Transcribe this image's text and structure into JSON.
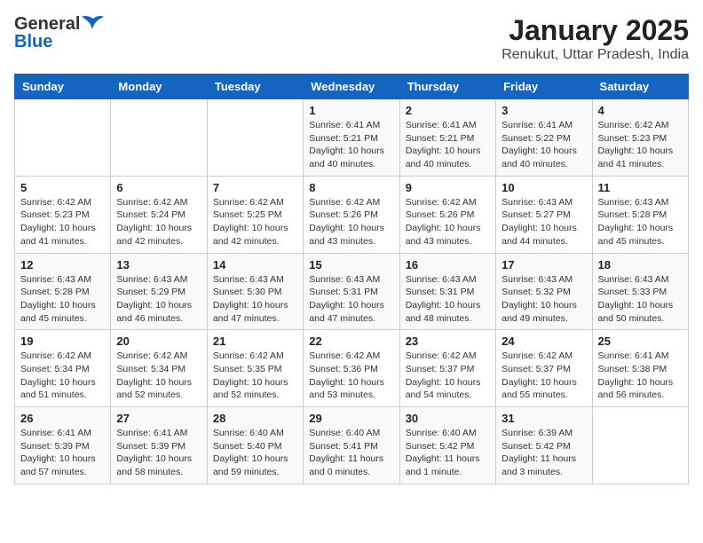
{
  "header": {
    "logo_general": "General",
    "logo_blue": "Blue",
    "title": "January 2025",
    "subtitle": "Renukut, Uttar Pradesh, India"
  },
  "days_of_week": [
    "Sunday",
    "Monday",
    "Tuesday",
    "Wednesday",
    "Thursday",
    "Friday",
    "Saturday"
  ],
  "weeks": [
    [
      {
        "day": "",
        "info": ""
      },
      {
        "day": "",
        "info": ""
      },
      {
        "day": "",
        "info": ""
      },
      {
        "day": "1",
        "info": "Sunrise: 6:41 AM\nSunset: 5:21 PM\nDaylight: 10 hours\nand 40 minutes."
      },
      {
        "day": "2",
        "info": "Sunrise: 6:41 AM\nSunset: 5:21 PM\nDaylight: 10 hours\nand 40 minutes."
      },
      {
        "day": "3",
        "info": "Sunrise: 6:41 AM\nSunset: 5:22 PM\nDaylight: 10 hours\nand 40 minutes."
      },
      {
        "day": "4",
        "info": "Sunrise: 6:42 AM\nSunset: 5:23 PM\nDaylight: 10 hours\nand 41 minutes."
      }
    ],
    [
      {
        "day": "5",
        "info": "Sunrise: 6:42 AM\nSunset: 5:23 PM\nDaylight: 10 hours\nand 41 minutes."
      },
      {
        "day": "6",
        "info": "Sunrise: 6:42 AM\nSunset: 5:24 PM\nDaylight: 10 hours\nand 42 minutes."
      },
      {
        "day": "7",
        "info": "Sunrise: 6:42 AM\nSunset: 5:25 PM\nDaylight: 10 hours\nand 42 minutes."
      },
      {
        "day": "8",
        "info": "Sunrise: 6:42 AM\nSunset: 5:26 PM\nDaylight: 10 hours\nand 43 minutes."
      },
      {
        "day": "9",
        "info": "Sunrise: 6:42 AM\nSunset: 5:26 PM\nDaylight: 10 hours\nand 43 minutes."
      },
      {
        "day": "10",
        "info": "Sunrise: 6:43 AM\nSunset: 5:27 PM\nDaylight: 10 hours\nand 44 minutes."
      },
      {
        "day": "11",
        "info": "Sunrise: 6:43 AM\nSunset: 5:28 PM\nDaylight: 10 hours\nand 45 minutes."
      }
    ],
    [
      {
        "day": "12",
        "info": "Sunrise: 6:43 AM\nSunset: 5:28 PM\nDaylight: 10 hours\nand 45 minutes."
      },
      {
        "day": "13",
        "info": "Sunrise: 6:43 AM\nSunset: 5:29 PM\nDaylight: 10 hours\nand 46 minutes."
      },
      {
        "day": "14",
        "info": "Sunrise: 6:43 AM\nSunset: 5:30 PM\nDaylight: 10 hours\nand 47 minutes."
      },
      {
        "day": "15",
        "info": "Sunrise: 6:43 AM\nSunset: 5:31 PM\nDaylight: 10 hours\nand 47 minutes."
      },
      {
        "day": "16",
        "info": "Sunrise: 6:43 AM\nSunset: 5:31 PM\nDaylight: 10 hours\nand 48 minutes."
      },
      {
        "day": "17",
        "info": "Sunrise: 6:43 AM\nSunset: 5:32 PM\nDaylight: 10 hours\nand 49 minutes."
      },
      {
        "day": "18",
        "info": "Sunrise: 6:43 AM\nSunset: 5:33 PM\nDaylight: 10 hours\nand 50 minutes."
      }
    ],
    [
      {
        "day": "19",
        "info": "Sunrise: 6:42 AM\nSunset: 5:34 PM\nDaylight: 10 hours\nand 51 minutes."
      },
      {
        "day": "20",
        "info": "Sunrise: 6:42 AM\nSunset: 5:34 PM\nDaylight: 10 hours\nand 52 minutes."
      },
      {
        "day": "21",
        "info": "Sunrise: 6:42 AM\nSunset: 5:35 PM\nDaylight: 10 hours\nand 52 minutes."
      },
      {
        "day": "22",
        "info": "Sunrise: 6:42 AM\nSunset: 5:36 PM\nDaylight: 10 hours\nand 53 minutes."
      },
      {
        "day": "23",
        "info": "Sunrise: 6:42 AM\nSunset: 5:37 PM\nDaylight: 10 hours\nand 54 minutes."
      },
      {
        "day": "24",
        "info": "Sunrise: 6:42 AM\nSunset: 5:37 PM\nDaylight: 10 hours\nand 55 minutes."
      },
      {
        "day": "25",
        "info": "Sunrise: 6:41 AM\nSunset: 5:38 PM\nDaylight: 10 hours\nand 56 minutes."
      }
    ],
    [
      {
        "day": "26",
        "info": "Sunrise: 6:41 AM\nSunset: 5:39 PM\nDaylight: 10 hours\nand 57 minutes."
      },
      {
        "day": "27",
        "info": "Sunrise: 6:41 AM\nSunset: 5:39 PM\nDaylight: 10 hours\nand 58 minutes."
      },
      {
        "day": "28",
        "info": "Sunrise: 6:40 AM\nSunset: 5:40 PM\nDaylight: 10 hours\nand 59 minutes."
      },
      {
        "day": "29",
        "info": "Sunrise: 6:40 AM\nSunset: 5:41 PM\nDaylight: 11 hours\nand 0 minutes."
      },
      {
        "day": "30",
        "info": "Sunrise: 6:40 AM\nSunset: 5:42 PM\nDaylight: 11 hours\nand 1 minute."
      },
      {
        "day": "31",
        "info": "Sunrise: 6:39 AM\nSunset: 5:42 PM\nDaylight: 11 hours\nand 3 minutes."
      },
      {
        "day": "",
        "info": ""
      }
    ]
  ]
}
